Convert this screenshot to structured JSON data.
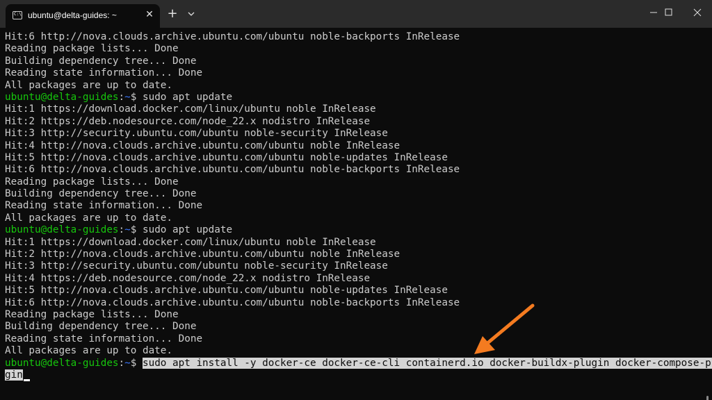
{
  "window": {
    "tab_title": "ubuntu@delta-guides: ~",
    "tab_icon_text": "C:\\",
    "close_tab_glyph": "✕",
    "new_tab_glyph": "+"
  },
  "prompt": {
    "user_host": "ubuntu@delta-guides",
    "separator": ":",
    "path": "~",
    "symbol": "$ "
  },
  "terminal": {
    "lines": [
      {
        "type": "out",
        "text": "Hit:6 http://nova.clouds.archive.ubuntu.com/ubuntu noble-backports InRelease"
      },
      {
        "type": "out",
        "text": "Reading package lists... Done"
      },
      {
        "type": "out",
        "text": "Building dependency tree... Done"
      },
      {
        "type": "out",
        "text": "Reading state information... Done"
      },
      {
        "type": "out",
        "text": "All packages are up to date."
      },
      {
        "type": "cmd",
        "text": "sudo apt update"
      },
      {
        "type": "out",
        "text": "Hit:1 https://download.docker.com/linux/ubuntu noble InRelease"
      },
      {
        "type": "out",
        "text": "Hit:2 https://deb.nodesource.com/node_22.x nodistro InRelease"
      },
      {
        "type": "out",
        "text": "Hit:3 http://security.ubuntu.com/ubuntu noble-security InRelease"
      },
      {
        "type": "out",
        "text": "Hit:4 http://nova.clouds.archive.ubuntu.com/ubuntu noble InRelease"
      },
      {
        "type": "out",
        "text": "Hit:5 http://nova.clouds.archive.ubuntu.com/ubuntu noble-updates InRelease"
      },
      {
        "type": "out",
        "text": "Hit:6 http://nova.clouds.archive.ubuntu.com/ubuntu noble-backports InRelease"
      },
      {
        "type": "out",
        "text": "Reading package lists... Done"
      },
      {
        "type": "out",
        "text": "Building dependency tree... Done"
      },
      {
        "type": "out",
        "text": "Reading state information... Done"
      },
      {
        "type": "out",
        "text": "All packages are up to date."
      },
      {
        "type": "cmd",
        "text": "sudo apt update"
      },
      {
        "type": "out",
        "text": "Hit:1 https://download.docker.com/linux/ubuntu noble InRelease"
      },
      {
        "type": "out",
        "text": "Hit:2 http://nova.clouds.archive.ubuntu.com/ubuntu noble InRelease"
      },
      {
        "type": "out",
        "text": "Hit:3 http://security.ubuntu.com/ubuntu noble-security InRelease"
      },
      {
        "type": "out",
        "text": "Hit:4 https://deb.nodesource.com/node_22.x nodistro InRelease"
      },
      {
        "type": "out",
        "text": "Hit:5 http://nova.clouds.archive.ubuntu.com/ubuntu noble-updates InRelease"
      },
      {
        "type": "out",
        "text": "Hit:6 http://nova.clouds.archive.ubuntu.com/ubuntu noble-backports InRelease"
      },
      {
        "type": "out",
        "text": "Reading package lists... Done"
      },
      {
        "type": "out",
        "text": "Building dependency tree... Done"
      },
      {
        "type": "out",
        "text": "Reading state information... Done"
      },
      {
        "type": "out",
        "text": "All packages are up to date."
      }
    ],
    "current_command_line1": "sudo apt install -y docker-ce docker-ce-cli containerd.io docker-buildx-plugin docker-compose-plu",
    "current_command_line2": "gin"
  },
  "colors": {
    "background": "#0c0c0c",
    "titlebar": "#2b2b2b",
    "text": "#cccccc",
    "prompt_user": "#16c60c",
    "prompt_path": "#3b78ff",
    "selection": "#d4d4d4",
    "annotation_arrow": "#f47b20"
  },
  "icons": {
    "tab": "terminal-icon",
    "close_tab": "close-icon",
    "new_tab": "plus-icon",
    "dropdown": "chevron-down-icon",
    "minimize": "minimize-icon",
    "maximize": "maximize-icon",
    "close_window": "close-icon"
  }
}
